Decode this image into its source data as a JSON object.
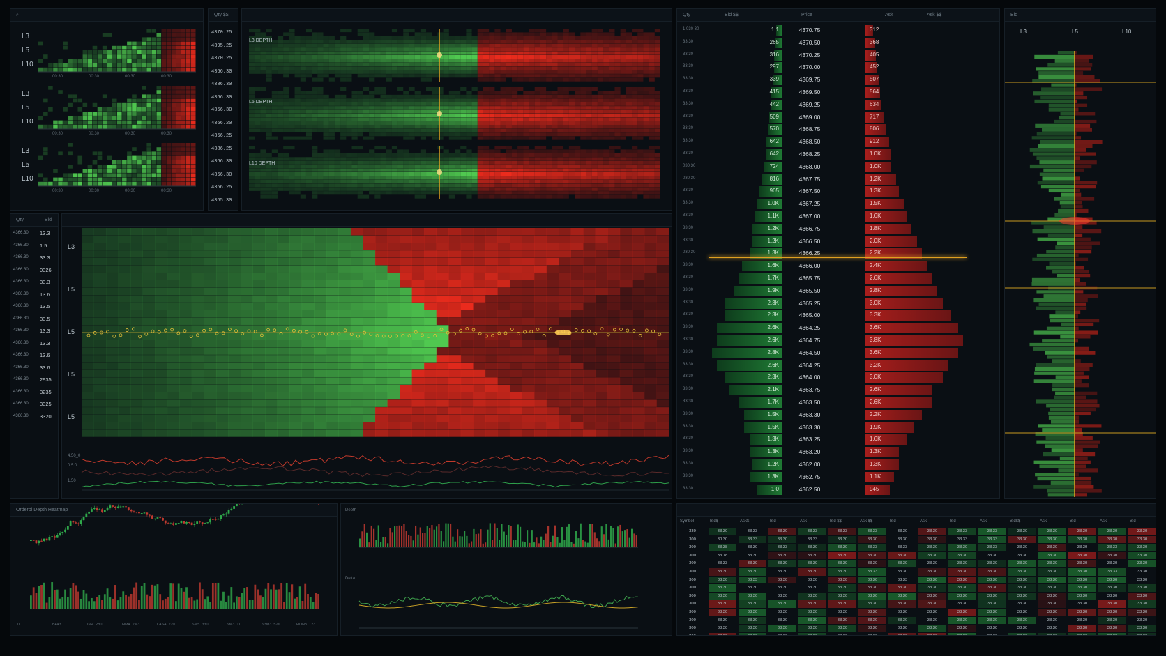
{
  "mini_depth": {
    "levels": [
      "L3",
      "L5",
      "L10"
    ],
    "time_ticks": [
      "00:30",
      "00:30",
      "00:30",
      "00:30"
    ]
  },
  "price_ladder_top": {
    "header": "Qty $$",
    "prices": [
      "4370.25",
      "4395.25",
      "4370.25",
      "4366.30",
      "4386.30",
      "4366.30",
      "4366.30",
      "4366.20",
      "4366.25",
      "4386.25",
      "4366.30",
      "4366.30",
      "4366.25",
      "4365.30"
    ]
  },
  "depth_strips": {
    "labels": [
      "L3 DEPTH",
      "L5 DEPTH",
      "L10 DEPTH"
    ]
  },
  "left_list": {
    "headers": [
      "Qty",
      "Bid"
    ],
    "rows": [
      {
        "price": "4366.30",
        "val": "13.3"
      },
      {
        "price": "4366.30",
        "val": "1.5"
      },
      {
        "price": "4366.30",
        "val": "33.3"
      },
      {
        "price": "4366.30",
        "val": "0326"
      },
      {
        "price": "4366.30",
        "val": "33.3"
      },
      {
        "price": "4366.30",
        "val": "13.6"
      },
      {
        "price": "4366.30",
        "val": "13.5"
      },
      {
        "price": "4366.30",
        "val": "33.5"
      },
      {
        "price": "4366.30",
        "val": "13.3"
      },
      {
        "price": "4366.30",
        "val": "13.3"
      },
      {
        "price": "4366.30",
        "val": "13.6"
      },
      {
        "price": "4366.30",
        "val": "33.6"
      },
      {
        "price": "4366.30",
        "val": "2935"
      },
      {
        "price": "4366.30",
        "val": "3235"
      },
      {
        "price": "4366.30",
        "val": "3325"
      },
      {
        "price": "4366.30",
        "val": "3320"
      }
    ]
  },
  "heatmap": {
    "levels": [
      "L3",
      "L5",
      "L5",
      "L5",
      "L5"
    ],
    "strip_labels": [
      "4.50_0",
      "0.5:0",
      "1.50"
    ]
  },
  "orderbook": {
    "headers": [
      "Qty",
      "Bid $$",
      "Price",
      "Ask",
      "Ask $$"
    ],
    "rows": [
      {
        "idx": "1 030 30",
        "bid": "1.1",
        "price": "4370.75",
        "ask": "312"
      },
      {
        "idx": "33 30",
        "bid": "265",
        "price": "4370.50",
        "ask": "368"
      },
      {
        "idx": "33 30",
        "bid": "316",
        "price": "4370.25",
        "ask": "405"
      },
      {
        "idx": "33 30",
        "bid": "297",
        "price": "4370.00",
        "ask": "452"
      },
      {
        "idx": "33 30",
        "bid": "339",
        "price": "4369.75",
        "ask": "507"
      },
      {
        "idx": "33 30",
        "bid": "415",
        "price": "4369.50",
        "ask": "564"
      },
      {
        "idx": "33 30",
        "bid": "442",
        "price": "4369.25",
        "ask": "634"
      },
      {
        "idx": "33 30",
        "bid": "509",
        "price": "4369.00",
        "ask": "717"
      },
      {
        "idx": "33 30",
        "bid": "570",
        "price": "4368.75",
        "ask": "806"
      },
      {
        "idx": "33 30",
        "bid": "642",
        "price": "4368.50",
        "ask": "912"
      },
      {
        "idx": "33 30",
        "bid": "642",
        "price": "4368.25",
        "ask": "1.0K"
      },
      {
        "idx": "030 30",
        "bid": "724",
        "price": "4368.00",
        "ask": "1.0K"
      },
      {
        "idx": "030 30",
        "bid": "816",
        "price": "4367.75",
        "ask": "1.2K"
      },
      {
        "idx": "33 30",
        "bid": "905",
        "price": "4367.50",
        "ask": "1.3K"
      },
      {
        "idx": "33 30",
        "bid": "1.0K",
        "price": "4367.25",
        "ask": "1.5K"
      },
      {
        "idx": "33 30",
        "bid": "1.1K",
        "price": "4367.00",
        "ask": "1.6K"
      },
      {
        "idx": "33 30",
        "bid": "1.2K",
        "price": "4366.75",
        "ask": "1.8K"
      },
      {
        "idx": "33 30",
        "bid": "1.2K",
        "price": "4366.50",
        "ask": "2.0K"
      },
      {
        "idx": "030 30",
        "bid": "1.3K",
        "price": "4366.25",
        "ask": "2.2K"
      },
      {
        "idx": "33 30",
        "bid": "1.6K",
        "price": "4366.00",
        "ask": "2.4K"
      },
      {
        "idx": "33 30",
        "bid": "1.7K",
        "price": "4365.75",
        "ask": "2.6K"
      },
      {
        "idx": "33 30",
        "bid": "1.9K",
        "price": "4365.50",
        "ask": "2.8K"
      },
      {
        "idx": "33 30",
        "bid": "2.3K",
        "price": "4365.25",
        "ask": "3.0K"
      },
      {
        "idx": "33 30",
        "bid": "2.3K",
        "price": "4365.00",
        "ask": "3.3K"
      },
      {
        "idx": "33 30",
        "bid": "2.6K",
        "price": "4364.25",
        "ask": "3.6K"
      },
      {
        "idx": "33 30",
        "bid": "2.6K",
        "price": "4364.75",
        "ask": "3.8K"
      },
      {
        "idx": "33 30",
        "bid": "2.8K",
        "price": "4364.50",
        "ask": "3.6K"
      },
      {
        "idx": "33 30",
        "bid": "2.6K",
        "price": "4364.25",
        "ask": "3.2K"
      },
      {
        "idx": "33 30",
        "bid": "2.3K",
        "price": "4364.00",
        "ask": "3.0K"
      },
      {
        "idx": "33 30",
        "bid": "2.1K",
        "price": "4363.75",
        "ask": "2.6K"
      },
      {
        "idx": "33 30",
        "bid": "1.7K",
        "price": "4363.50",
        "ask": "2.6K"
      },
      {
        "idx": "33 30",
        "bid": "1.5K",
        "price": "4363.30",
        "ask": "2.2K"
      },
      {
        "idx": "33 30",
        "bid": "1.5K",
        "price": "4363.30",
        "ask": "1.9K"
      },
      {
        "idx": "33 30",
        "bid": "1.3K",
        "price": "4363.25",
        "ask": "1.6K"
      },
      {
        "idx": "33 30",
        "bid": "1.3K",
        "price": "4363.20",
        "ask": "1.3K"
      },
      {
        "idx": "33 30",
        "bid": "1.2K",
        "price": "4362.00",
        "ask": "1.3K"
      },
      {
        "idx": "33 30",
        "bid": "1.3K",
        "price": "4362.75",
        "ask": "1.1K"
      },
      {
        "idx": "33 30",
        "bid": "1.0",
        "price": "4362.50",
        "ask": "945"
      }
    ],
    "bid_values": [
      1.1,
      265,
      316,
      297,
      339,
      415,
      442,
      509,
      570,
      642,
      642,
      724,
      816,
      905,
      1000,
      1100,
      1200,
      1200,
      1300,
      1600,
      1700,
      1900,
      2300,
      2300,
      2600,
      2600,
      2800,
      2600,
      2300,
      2100,
      1700,
      1500,
      1500,
      1300,
      1300,
      1200,
      1300,
      1000
    ],
    "ask_values": [
      312,
      368,
      405,
      452,
      507,
      564,
      634,
      717,
      806,
      912,
      1000,
      1000,
      1200,
      1300,
      1500,
      1600,
      1800,
      2000,
      2200,
      2400,
      2600,
      2800,
      3000,
      3300,
      3600,
      3800,
      3600,
      3200,
      3000,
      2600,
      2600,
      2200,
      1900,
      1600,
      1300,
      1300,
      1100,
      945
    ]
  },
  "right_depth": {
    "header": "Bid",
    "levels": [
      "L3",
      "L5",
      "L10"
    ]
  },
  "bottom_left": {
    "title": "Orderbl Depth Heatmap",
    "time_ticks": [
      "0",
      "Bk43",
      "IM4 .280",
      "HM4 .2M3",
      "LAS4 .220",
      "SM5 .330",
      "SM3 .11",
      "S3M3 .526",
      "HDN3 .123"
    ]
  },
  "bottom_mid": {
    "labels": [
      "Depth",
      "Delta"
    ]
  },
  "bottom_table": {
    "headers": [
      "Symbol",
      "Bid$",
      "Ask$",
      "Bid",
      "Ask",
      "Bid $$",
      "Ask $$",
      "Bid",
      "Ask",
      "Bid",
      "Ask",
      "Bid$$",
      "Ask",
      "Bid",
      "Ask",
      "Bid"
    ],
    "rows": [
      [
        "330",
        "33.30",
        "33.33",
        "33.30",
        "33.33",
        "33.33",
        "33.33",
        "33.30",
        "33.30",
        "33.33",
        "33.33",
        "33.30",
        "33.30",
        "33.30",
        "33.30",
        "33.30"
      ],
      [
        "300",
        "30.30",
        "33.33",
        "33.30",
        "33.33",
        "33.30",
        "33.30",
        "33.30",
        "33.30",
        "33.33",
        "33.33",
        "33.30",
        "33.30",
        "33.30",
        "33.30",
        "33.30"
      ],
      [
        "300",
        "33.38",
        "33.30",
        "33.33",
        "33.30",
        "33.30",
        "33.33",
        "33.33",
        "33.30",
        "33.30",
        "33.33",
        "33.30",
        "33.30",
        "33.30",
        "33.33",
        "33.30"
      ],
      [
        "300",
        "33.78",
        "33.30",
        "33.30",
        "33.30",
        "33.30",
        "33.30",
        "33.30",
        "33.30",
        "33.30",
        "33.30",
        "33.30",
        "33.30",
        "33.30",
        "33.30",
        "33.30"
      ],
      [
        "300",
        "33.33",
        "33.30",
        "33.30",
        "33.30",
        "33.30",
        "33.30",
        "33.30",
        "33.30",
        "33.30",
        "33.30",
        "33.30",
        "33.30",
        "33.30",
        "33.30",
        "33.30"
      ],
      [
        "300",
        "33.30",
        "33.30",
        "33.30",
        "33.30",
        "33.30",
        "33.33",
        "33.30",
        "33.30",
        "33.30",
        "33.30",
        "33.30",
        "33.30",
        "33.30",
        "33.33",
        "33.30"
      ],
      [
        "300",
        "33.30",
        "33.33",
        "33.30",
        "33.30",
        "33.30",
        "33.30",
        "33.33",
        "33.30",
        "33.30",
        "33.30",
        "33.30",
        "33.30",
        "33.30",
        "33.30",
        "33.30"
      ],
      [
        "300",
        "33.30",
        "33.30",
        "33.30",
        "33.30",
        "33.30",
        "33.30",
        "33.30",
        "33.30",
        "33.30",
        "33.30",
        "33.30",
        "33.30",
        "33.30",
        "33.30",
        "33.30"
      ],
      [
        "300",
        "33.30",
        "33.30",
        "33.30",
        "33.30",
        "33.30",
        "33.30",
        "33.30",
        "33.30",
        "33.30",
        "33.30",
        "33.30",
        "33.30",
        "33.30",
        "33.30",
        "33.30"
      ],
      [
        "300",
        "33.30",
        "33.30",
        "33.30",
        "33.30",
        "33.30",
        "33.30",
        "33.30",
        "33.30",
        "33.30",
        "33.30",
        "33.30",
        "33.30",
        "33.30",
        "33.30",
        "33.30"
      ],
      [
        "300",
        "33.30",
        "33.30",
        "33.30",
        "33.30",
        "33.30",
        "33.30",
        "33.30",
        "33.30",
        "33.30",
        "33.30",
        "33.30",
        "33.30",
        "33.30",
        "33.30",
        "33.30"
      ],
      [
        "300",
        "33.30",
        "33.30",
        "33.30",
        "33.30",
        "33.30",
        "33.30",
        "33.30",
        "33.30",
        "33.30",
        "33.30",
        "33.30",
        "33.30",
        "33.30",
        "33.30",
        "33.30"
      ],
      [
        "300",
        "33.30",
        "33.30",
        "33.30",
        "33.30",
        "33.30",
        "33.30",
        "33.30",
        "33.30",
        "33.30",
        "33.30",
        "33.30",
        "33.30",
        "33.30",
        "33.30",
        "33.30"
      ],
      [
        "300",
        "33.30",
        "33.30",
        "33.30",
        "33.30",
        "33.30",
        "33.30",
        "33.30",
        "33.30",
        "33.30",
        "33.30",
        "33.30",
        "33.30",
        "33.30",
        "33.30",
        "33.30"
      ]
    ]
  },
  "colors": {
    "bid": "#1f7a34",
    "ask": "#b01e1c",
    "accent": "#e0a020",
    "bg": "#05080b"
  }
}
